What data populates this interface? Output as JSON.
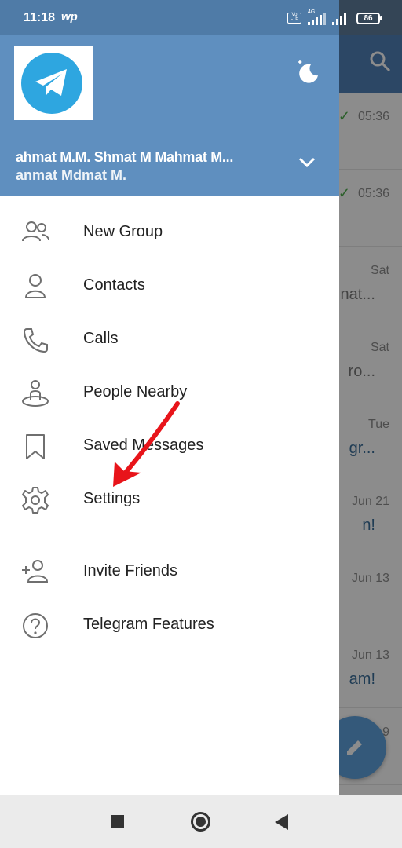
{
  "status_bar": {
    "time": "11:18",
    "carrier_icon": "wp",
    "volte": "Vo LTE",
    "network": "4G",
    "battery": "86"
  },
  "drawer": {
    "account_name": "ahmat M.M. Shmat M Mahmat M...",
    "account_name_line2": "anmat Mdmat M.",
    "menu": [
      {
        "label": "New Group",
        "icon": "group-icon"
      },
      {
        "label": "Contacts",
        "icon": "contact-icon"
      },
      {
        "label": "Calls",
        "icon": "phone-icon"
      },
      {
        "label": "People Nearby",
        "icon": "people-nearby-icon"
      },
      {
        "label": "Saved Messages",
        "icon": "bookmark-icon"
      },
      {
        "label": "Settings",
        "icon": "gear-icon"
      }
    ],
    "menu_secondary": [
      {
        "label": "Invite Friends",
        "icon": "add-person-icon"
      },
      {
        "label": "Telegram Features",
        "icon": "question-icon"
      }
    ]
  },
  "chat_list_background": {
    "rows": [
      {
        "time": "05:36",
        "read": true,
        "snippet": ""
      },
      {
        "time": "05:36",
        "read": true,
        "snippet": ""
      },
      {
        "time": "Sat",
        "read": false,
        "snippet": "nat..."
      },
      {
        "time": "Sat",
        "read": false,
        "snippet": "ro..."
      },
      {
        "time": "Tue",
        "read": false,
        "snippet": "gr..."
      },
      {
        "time": "Jun 21",
        "read": false,
        "snippet": "n!"
      },
      {
        "time": "Jun 13",
        "read": false,
        "snippet": ""
      },
      {
        "time": "Jun 13",
        "read": false,
        "snippet": "am!"
      },
      {
        "time": "9",
        "read": false,
        "snippet": ""
      }
    ]
  },
  "colors": {
    "header": "#5f8fbf",
    "accent": "#2ea6e0",
    "annotation": "#e8141a"
  }
}
